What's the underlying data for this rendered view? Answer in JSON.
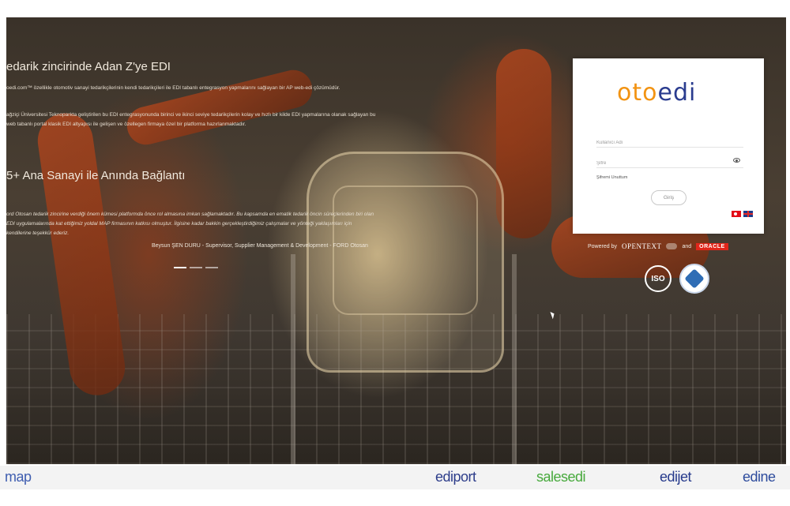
{
  "hero": {
    "heading_1": "edarik zincirinde Adan Z'ye EDI",
    "paragraph_1": "oedi.com™ özellikle otomotiv sanayi tedarikçilerinin kendi tedarikçileri ile EDI tabanlı entegrasyon yapmalarını sağlayan bir AP web-edi çözümüdür.",
    "paragraph_2": "ağziçi Üniversitesi Teknoparkta geliştirilen bu EDI entegrasyonunda birinci ve ikinci seviye tedarikçilerin kolay ve hızlı bir kilde EDI yapmalarına olanak sağlayan bu web tabanlı portal klasik EDI altyapısı ile gelişen ve özellegen firmaya özel bir platforma hazırlanmaktadır.",
    "heading_2": "5+ Ana Sanayi ile Anında Bağlantı",
    "quote": "ord Otosan tedarik zincirine verdiği önem kümesi platformda önce rol almasına imkan sağlamaktadır. Bu kapsamda en ematik tedarik öncin süreçlerinden biri olan EDI uygulamalarında kat ettiğimiz yoldal MAP firmasının katkısı olmuştur. İlgisine kadar bakkin gerçekleştirdiğimiz çalışmalar ve yönteği yaklaşımları için kendilerine teşekkür ederiz.",
    "quote_author": "Beysun ŞEN DURU - Supervisor, Supplier Management & Development - FORD Otosan"
  },
  "login": {
    "logo_part1": "oto",
    "logo_part2": "edi",
    "username_placeholder": "Kullanıcı Adı",
    "password_placeholder": "Şifre",
    "forgot_label": "Şifremi Unuttum",
    "login_label": "Giriş"
  },
  "powered": {
    "label": "Powered by",
    "opentext": "OPENTEXT",
    "and": "and",
    "oracle": "ORACLE",
    "iso": "ISO"
  },
  "brands": [
    "map",
    "ediport",
    "salesedi",
    "edijet",
    "edine"
  ],
  "colors": {
    "logo_orange": "#f29312",
    "logo_blue": "#2a3c8f",
    "oracle_red": "#e0261a",
    "salesedi_green": "#47a93c"
  }
}
